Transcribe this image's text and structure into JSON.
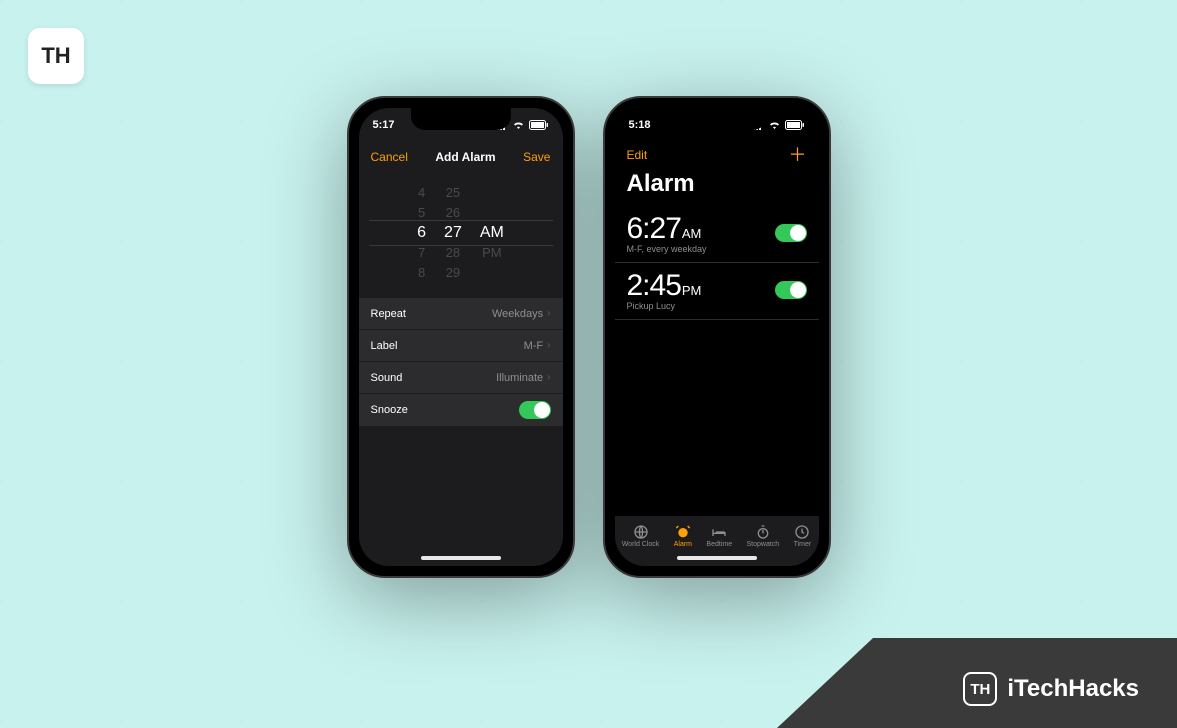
{
  "brand": {
    "top_logo": "TH",
    "footer_logo": "TH",
    "footer_name": "iTechHacks"
  },
  "phone_left": {
    "status_time": "5:17",
    "nav": {
      "cancel": "Cancel",
      "title": "Add Alarm",
      "save": "Save"
    },
    "picker": {
      "hours": [
        "4",
        "5",
        "6",
        "7",
        "8"
      ],
      "minutes": [
        "25",
        "26",
        "27",
        "28",
        "29"
      ],
      "periods": [
        "AM",
        "PM"
      ],
      "selected": {
        "hour": "6",
        "minute": "27",
        "period": "AM"
      }
    },
    "rows": {
      "repeat": {
        "label": "Repeat",
        "value": "Weekdays"
      },
      "label": {
        "label": "Label",
        "value": "M-F"
      },
      "sound": {
        "label": "Sound",
        "value": "Illuminate"
      },
      "snooze": {
        "label": "Snooze"
      }
    }
  },
  "phone_right": {
    "status_time": "5:18",
    "nav": {
      "edit": "Edit"
    },
    "title": "Alarm",
    "alarms": [
      {
        "time": "6:27",
        "ampm": "AM",
        "sub": "M-F, every weekday"
      },
      {
        "time": "2:45",
        "ampm": "PM",
        "sub": "Pickup Lucy"
      }
    ],
    "tabs": [
      {
        "name": "World Clock"
      },
      {
        "name": "Alarm"
      },
      {
        "name": "Bedtime"
      },
      {
        "name": "Stopwatch"
      },
      {
        "name": "Timer"
      }
    ]
  }
}
